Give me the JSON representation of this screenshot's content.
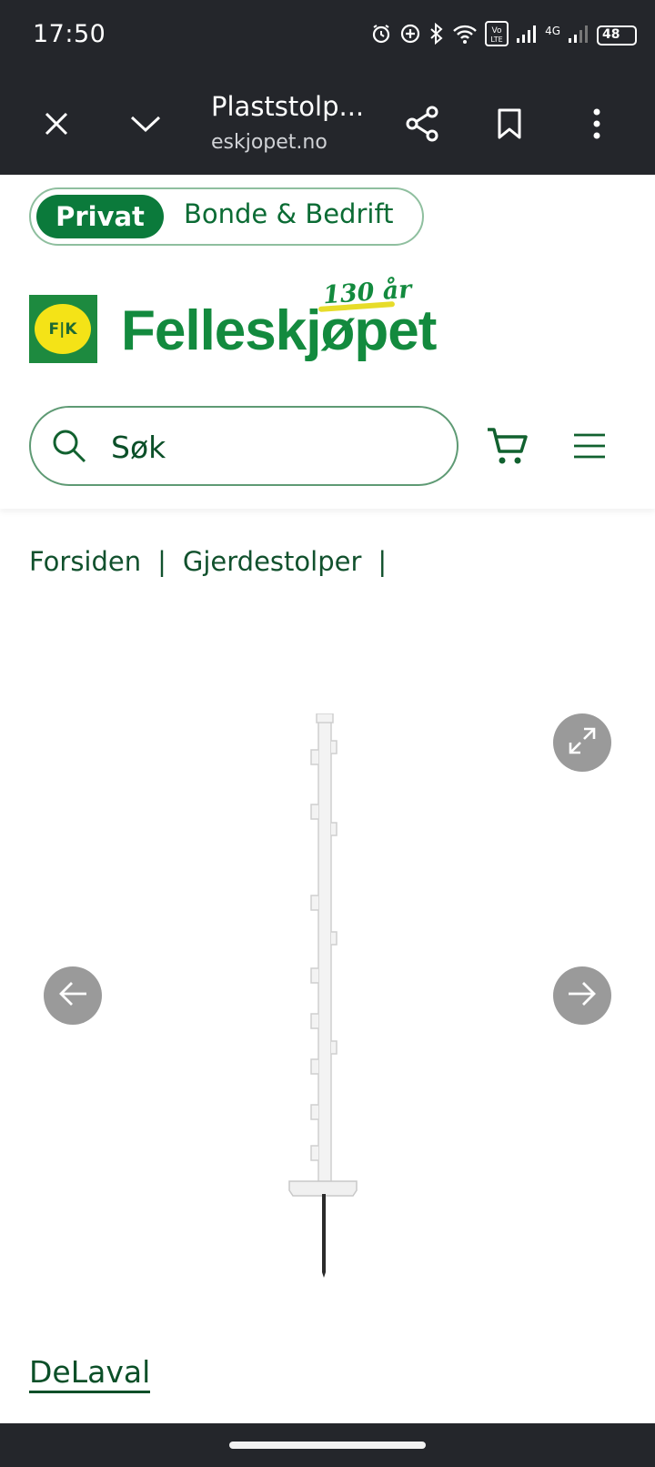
{
  "status_bar": {
    "time": "17:50",
    "battery": "48",
    "network": "4G",
    "icons": [
      "alarm-icon",
      "data-saver-icon",
      "bluetooth-icon",
      "wifi-icon",
      "volte-icon",
      "signal-icon",
      "battery-icon"
    ]
  },
  "browser": {
    "title": "Plaststolp...",
    "url": "eskjopet.no",
    "icons": [
      "close-icon",
      "chevron-down-icon",
      "share-icon",
      "bookmark-icon",
      "more-icon"
    ]
  },
  "site": {
    "segment": {
      "active": "Privat",
      "other": "Bonde & Bedrift"
    },
    "logo": {
      "badge": "F|K",
      "name": "Felleskjøpet",
      "anniversary": "130 år"
    },
    "search": {
      "placeholder": "Søk"
    }
  },
  "breadcrumb": {
    "items": [
      "Forsiden",
      "Gjerdestolper"
    ],
    "separator": "|"
  },
  "product": {
    "brand": "DeLaval"
  },
  "colors": {
    "brand_green": "#0b7a3b",
    "dark_green": "#11512d",
    "logo_yellow": "#f4e317",
    "chrome": "#24262b"
  }
}
